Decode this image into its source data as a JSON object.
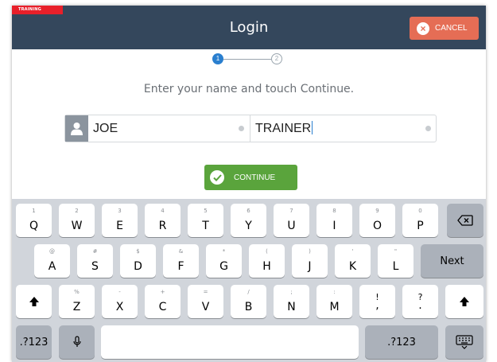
{
  "header": {
    "training_badge": "TRAINING",
    "title": "Login",
    "cancel_label": "CANCEL"
  },
  "steps": {
    "current": "1",
    "next": "2"
  },
  "instruction": "Enter your name and touch Continue.",
  "form": {
    "first_name_value": "JOE",
    "last_name_value": "TRAINER"
  },
  "continue_label": "CONTINUE",
  "keyboard": {
    "row1": [
      {
        "sub": "1",
        "main": "Q"
      },
      {
        "sub": "2",
        "main": "W"
      },
      {
        "sub": "3",
        "main": "E"
      },
      {
        "sub": "4",
        "main": "R"
      },
      {
        "sub": "5",
        "main": "T"
      },
      {
        "sub": "6",
        "main": "Y"
      },
      {
        "sub": "7",
        "main": "U"
      },
      {
        "sub": "8",
        "main": "I"
      },
      {
        "sub": "9",
        "main": "O"
      },
      {
        "sub": "0",
        "main": "P"
      }
    ],
    "row2": [
      {
        "sub": "@",
        "main": "A"
      },
      {
        "sub": "#",
        "main": "S"
      },
      {
        "sub": "$",
        "main": "D"
      },
      {
        "sub": "&",
        "main": "F"
      },
      {
        "sub": "*",
        "main": "G"
      },
      {
        "sub": "(",
        "main": "H"
      },
      {
        "sub": ")",
        "main": "J"
      },
      {
        "sub": "'",
        "main": "K"
      },
      {
        "sub": "\"",
        "main": "L"
      }
    ],
    "row3": [
      {
        "sub": "%",
        "main": "Z"
      },
      {
        "sub": "-",
        "main": "X"
      },
      {
        "sub": "+",
        "main": "C"
      },
      {
        "sub": "=",
        "main": "V"
      },
      {
        "sub": "/",
        "main": "B"
      },
      {
        "sub": ";",
        "main": "N"
      },
      {
        "sub": ":",
        "main": "M"
      },
      {
        "sub": "!",
        "main": ","
      },
      {
        "sub": "?",
        "main": "."
      }
    ],
    "next_label": "Next",
    "numbers_label": ".?123",
    "icons": {
      "backspace": "backspace-icon",
      "shift": "shift-icon",
      "mic": "microphone-icon",
      "dismiss": "keyboard-dismiss-icon"
    }
  },
  "colors": {
    "header_bg": "#34475c",
    "cancel_bg": "#e56d55",
    "continue_bg": "#5aa43c",
    "step_active": "#2a7fcf",
    "training_red": "#e8202a",
    "keyboard_bg": "#d1d5db"
  }
}
